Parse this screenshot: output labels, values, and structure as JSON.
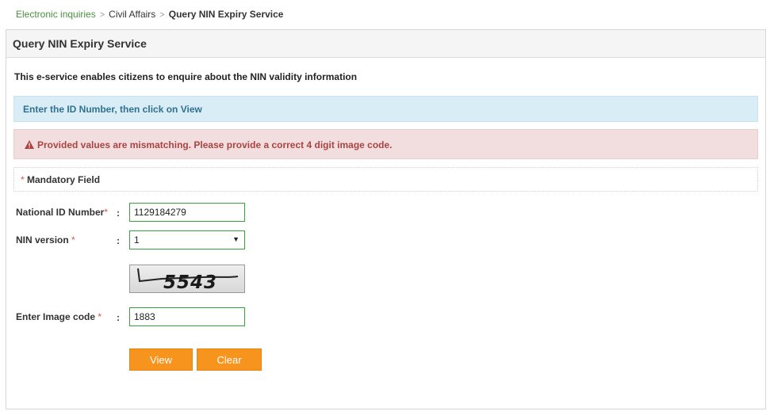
{
  "breadcrumb": {
    "items": [
      "Electronic inquiries",
      "Civil Affairs",
      "Query NIN Expiry Service"
    ],
    "separator": ">"
  },
  "panel": {
    "title": "Query NIN Expiry Service",
    "intro": "This e-service enables citizens to enquire about the NIN validity information"
  },
  "alerts": {
    "info": "Enter the ID Number, then click on View",
    "error": "Provided values are mismatching. Please provide a correct 4 digit image code.",
    "error_icon": "warning-icon"
  },
  "mandatory": {
    "asterisk": "*",
    "label": "Mandatory Field"
  },
  "form": {
    "colon": ":",
    "national_id": {
      "label": "National ID Number",
      "required": "*",
      "value": "1129184279"
    },
    "nin_version": {
      "label": "NIN version",
      "required": "*",
      "selected": "1"
    },
    "captcha": {
      "text": "5543"
    },
    "image_code": {
      "label": "Enter Image code",
      "required": "*",
      "value": "1883"
    }
  },
  "buttons": {
    "view": "View",
    "clear": "Clear"
  },
  "colors": {
    "link_green": "#4a8f3f",
    "info_bg": "#d9edf7",
    "info_text": "#31708f",
    "danger_bg": "#f2dede",
    "danger_text": "#a94442",
    "input_border": "#3aa13a",
    "button_orange": "#f7941d"
  }
}
